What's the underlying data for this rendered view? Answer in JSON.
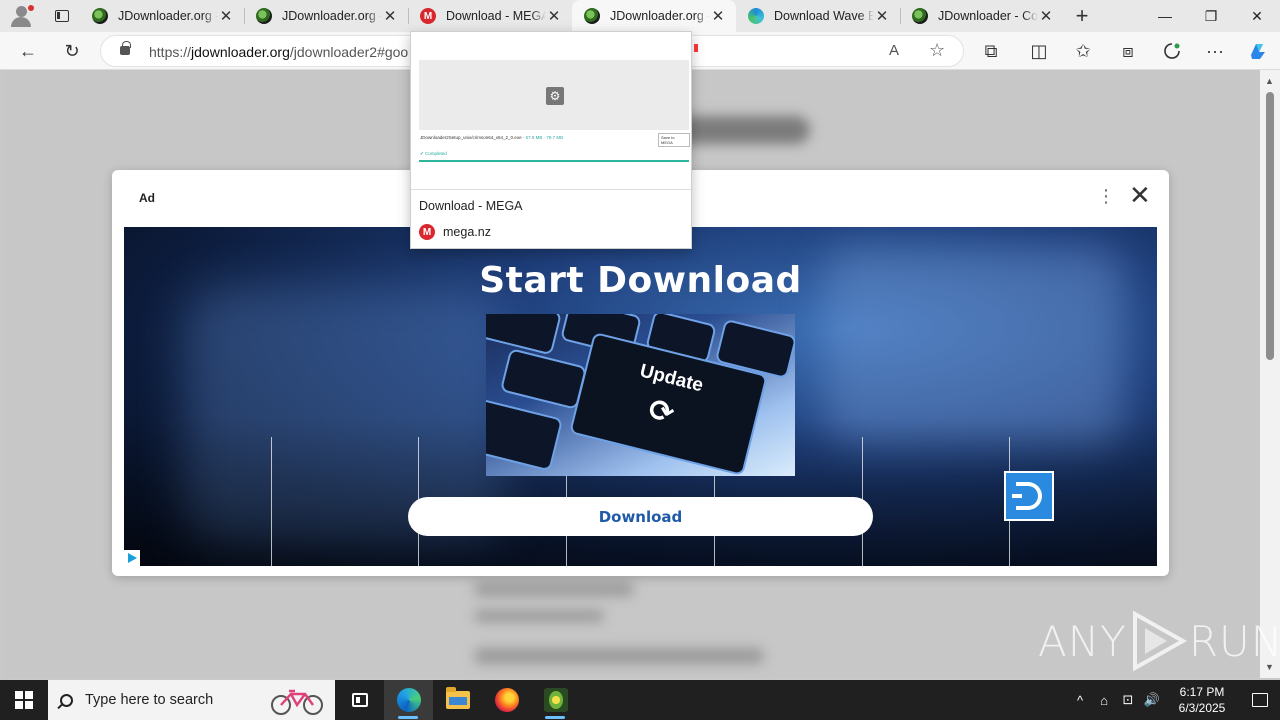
{
  "browser": {
    "tabs": [
      {
        "title": "JDownloader.org -",
        "favicon": "globe-icon"
      },
      {
        "title": "JDownloader.org -",
        "favicon": "globe-icon"
      },
      {
        "title": "Download - MEGA",
        "favicon": "mega-icon"
      },
      {
        "title": "JDownloader.org -",
        "favicon": "globe-icon",
        "active": true
      },
      {
        "title": "Download Wave Br",
        "favicon": "edge-icon"
      },
      {
        "title": "JDownloader - Cor",
        "favicon": "globe-icon"
      }
    ],
    "close_glyph": "✕",
    "new_tab_glyph": "+",
    "window_controls": {
      "minimize": "—",
      "maximize": "❐",
      "close": "✕"
    },
    "nav": {
      "back": "←",
      "refresh": "↻"
    },
    "address": {
      "scheme": "https://",
      "domain": "jdownloader.org",
      "path": "/jdownloader2#goo"
    },
    "toolbar_icons": {
      "read_aloud": "A",
      "favorite": "☆",
      "extensions": "⧉",
      "split": "◫",
      "favorites": "✩",
      "collections": "⧈",
      "more": "···"
    }
  },
  "ad_modal": {
    "label": "Ad",
    "more_glyph": "⋮",
    "close_glyph": "✕",
    "headline": "Start Download",
    "key_text": "Update",
    "key_symbol": "⟳",
    "download_button": "Download",
    "accent_color": "#1f5aa8"
  },
  "tab_preview": {
    "title": "Download - MEGA",
    "site": "mega.nz",
    "thumbnail": {
      "file_name": "JDownloader2Setup_unix/crimson64_x64_2_0.exe",
      "file_size": "57.9 MB · 79.7 MB",
      "save_button": "Save to MEGA",
      "status": "✔ Completed"
    }
  },
  "watermark": {
    "left": "ANY",
    "right": "RUN"
  },
  "taskbar": {
    "search_placeholder": "Type here to search",
    "time": "6:17 PM",
    "date": "6/3/2025",
    "tray_icons": {
      "chevron": "^",
      "meet": "⌂",
      "network": "⊡",
      "volume": "🔊"
    }
  }
}
